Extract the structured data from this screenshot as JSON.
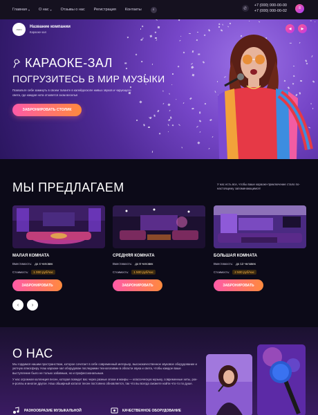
{
  "nav": {
    "items": [
      {
        "label": "Главная",
        "has_dropdown": true
      },
      {
        "label": "О нас",
        "has_dropdown": true
      },
      {
        "label": "Отзывы о нас",
        "has_dropdown": false
      },
      {
        "label": "Регистрация",
        "has_dropdown": false
      },
      {
        "label": "Контакты",
        "has_dropdown": false
      }
    ],
    "phones": [
      "+7 (000) 000-00-00",
      "+7 (000) 000-00-02"
    ],
    "icons": {
      "search": "search-icon",
      "phone": "phone-icon",
      "menu": "menu-icon"
    }
  },
  "hero": {
    "logo_text": "лого",
    "company_name": "Название компании",
    "company_sub": "Караоке-зал",
    "title": "КАРАОКЕ-ЗАЛ",
    "subtitle": "ПОГРУЗИТЕСЬ В МИР МУЗЫКИ",
    "text": "Позвольте себе замкнуть в своем таланте в калейдоскопе живых звуков и чарующего света, где каждая нота отзовется эхом веселья",
    "cta": "ЗАБРОНИРОВАТЬ СТОЛИК"
  },
  "offers": {
    "title": "МЫ ПРЕДЛАГАЕМ",
    "note": "У нас есть все, чтобы ваше караоке-приключение стало по-настоящему запоминающимся!",
    "capacity_label": "Вместимость:",
    "price_label": "Стоимость:",
    "book_label": "ЗАБРОНИРОВАТЬ",
    "rooms": [
      {
        "name": "МАЛАЯ КОМНАТА",
        "capacity": "до 4 человек",
        "price": "1 000 руб/час"
      },
      {
        "name": "СРЕДНЯЯ КОМНАТА",
        "capacity": "до 8 человек",
        "price": "1 500 руб/час"
      },
      {
        "name": "БОЛЬШАЯ КОМНАТА",
        "capacity": "до 12 человек",
        "price": "2 500 руб/час"
      }
    ],
    "prev_arrow": "‹",
    "next_arrow": "›"
  },
  "about": {
    "title": "О НАС",
    "paragraphs": [
      "Мы гордимся нашим пространством, которое сочетает в себе современный интерьер, высококачественное звуковое оборудование и уютную атмосферу. Наш караоке-зал оборудован последними технологиями в области звука и света, чтобы каждое ваше выступление было не только забавным, но и профессиональным.",
      "У нас огромная коллекция песен, которая поведет вас через разные эпохи и жанры — классическую музыку, современные хиты, рок-н-роллы и многое другое. Наш обширный каталог песен постоянно обновляется, так что вы всегда сможете найти что-то по душе."
    ],
    "features": [
      {
        "label": "РАЗНООБРАЗИЕ МУЗЫКАЛЬНОЙ",
        "icon": "music-note-icon"
      },
      {
        "label": "КАЧЕСТВЕННОЕ ОБОРУДОВАНИЕ",
        "icon": "equipment-icon"
      }
    ]
  },
  "colors": {
    "accent_start": "#ff5aa7",
    "accent_end": "#ff8a3d",
    "hero_bg": "#6a3dbf",
    "dark_bg": "#0c0a18",
    "price_text": "#ffb547"
  }
}
